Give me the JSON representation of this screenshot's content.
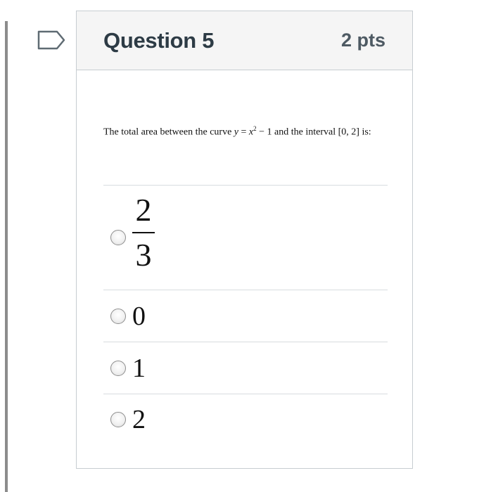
{
  "question": {
    "title": "Question 5",
    "points": "2 pts",
    "text_before": "The total area between the curve ",
    "eq_y": "y",
    "eq_equals": " = ",
    "eq_x": "x",
    "eq_exp": "2",
    "eq_rest": " − 1",
    "text_middle": " and the interval ",
    "interval": "[0, 2]",
    "text_after": " is:"
  },
  "answers": [
    {
      "numerator": "2",
      "denominator": "3"
    },
    {
      "label": "0"
    },
    {
      "label": "1"
    },
    {
      "label": "2"
    }
  ],
  "icons": {
    "flag": "flag-outline-icon",
    "radio": "radio-button-icon"
  },
  "colors": {
    "header_bg": "#f5f5f5",
    "title": "#2d3b45",
    "border": "#c7cdd1"
  }
}
